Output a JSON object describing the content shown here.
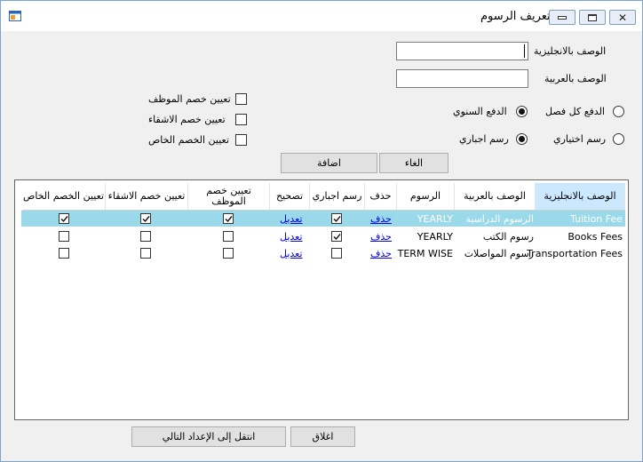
{
  "window": {
    "title": "تعريف الرسوم"
  },
  "form": {
    "english_desc_label": "الوصف بالانجليزية",
    "english_desc_value": "",
    "arabic_desc_label": "الوصف بالعربية",
    "arabic_desc_value": ""
  },
  "payment": {
    "per_term_label": "الدفع كل فصل",
    "yearly_label": "الدفع السنوي",
    "selected": "yearly"
  },
  "fee_kind": {
    "optional_label": "رسم اختياري",
    "mandatory_label": "رسم اجباري",
    "selected": "mandatory"
  },
  "discounts": {
    "employee_label": "تعيين خصم الموظف",
    "siblings_label": "تعيين خصم الاشقاء",
    "special_label": "تعيين الخصم الخاص"
  },
  "buttons": {
    "add": "اضافة",
    "cancel": "الغاء",
    "close": "اغلاق",
    "next": "انتقل إلى الإعداد التالي"
  },
  "grid": {
    "headers": [
      "الوصف بالانجليزية",
      "الوصف بالعربية",
      "الرسوم",
      "حذف",
      "رسم اجباري",
      "تصحيح",
      "تعيين خصم الموظف",
      "تعيين خصم الاشقاء",
      "تعيين الخصم الخاص"
    ],
    "rows": [
      {
        "en": "Tuition Fee",
        "ar": "الرسوم الدراسية",
        "fee": "YEARLY",
        "delete": "حذف",
        "mandatory": true,
        "edit": "تعديل",
        "employee": true,
        "siblings": true,
        "special": true,
        "selected": true
      },
      {
        "en": "Books Fees",
        "ar": "رسوم الكتب",
        "fee": "YEARLY",
        "delete": "حذف",
        "mandatory": true,
        "edit": "تعديل",
        "employee": false,
        "siblings": false,
        "special": false,
        "selected": false
      },
      {
        "en": "Transportation Fees",
        "ar": "رسوم المواصلات",
        "fee": "TERM WISE",
        "delete": "حذف",
        "mandatory": false,
        "edit": "تعديل",
        "employee": false,
        "siblings": false,
        "special": false,
        "selected": false
      }
    ]
  },
  "icons": {
    "app": "window-form-icon",
    "minimize": "minimize-icon",
    "maximize": "maximize-icon",
    "close": "close-icon",
    "check": "checkmark-icon"
  },
  "colors": {
    "selected_row": "#99d9ea",
    "selected_header": "#cce8ff",
    "link": "#0000ee"
  }
}
